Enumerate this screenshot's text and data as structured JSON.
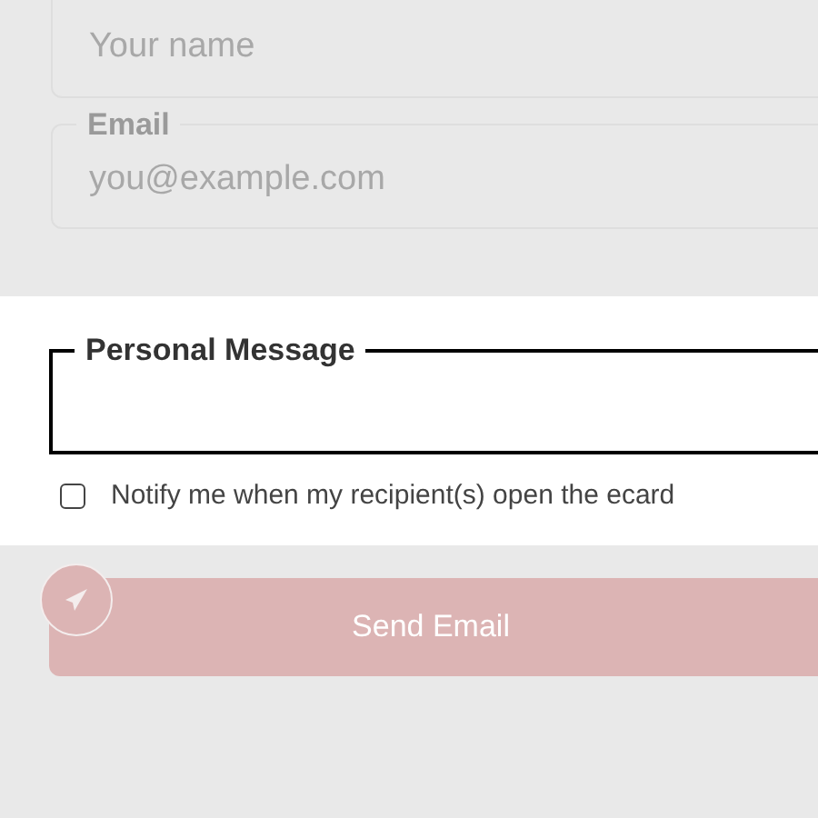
{
  "name_field": {
    "placeholder": "Your name"
  },
  "email_field": {
    "label": "Email",
    "placeholder": "you@example.com"
  },
  "personal_message": {
    "label": "Personal Message"
  },
  "notify_option": {
    "label": "Notify me when my recipient(s) open the ecard",
    "checked": false
  },
  "send_button": {
    "label": "Send Email",
    "disabled": true
  }
}
